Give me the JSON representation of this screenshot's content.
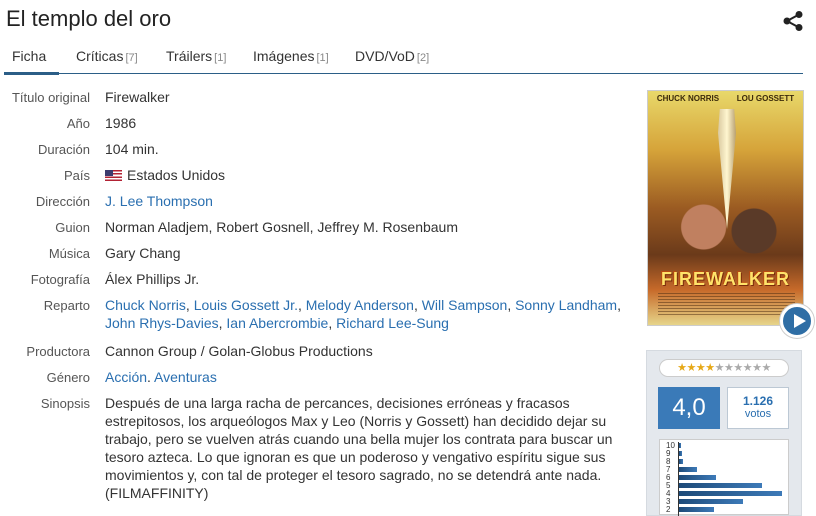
{
  "page": {
    "title": "El templo del oro"
  },
  "tabs": [
    {
      "label": "Ficha",
      "count": ""
    },
    {
      "label": "Críticas",
      "count": "[7]"
    },
    {
      "label": "Tráilers",
      "count": "[1]"
    },
    {
      "label": "Imágenes",
      "count": "[1]"
    },
    {
      "label": "DVD/VoD",
      "count": "[2]"
    }
  ],
  "details": {
    "original_title_label": "Título original",
    "original_title": "Firewalker",
    "year_label": "Año",
    "year": "1986",
    "duration_label": "Duración",
    "duration": "104 min.",
    "country_label": "País",
    "country": "Estados Unidos",
    "director_label": "Dirección",
    "director": "J. Lee Thompson",
    "screenplay_label": "Guion",
    "screenplay": "Norman Aladjem, Robert Gosnell, Jeffrey M. Rosenbaum",
    "music_label": "Música",
    "music": "Gary Chang",
    "photography_label": "Fotografía",
    "photography": "Álex Phillips Jr.",
    "cast_label": "Reparto",
    "cast": [
      "Chuck Norris",
      "Louis Gossett Jr.",
      "Melody Anderson",
      "Will Sampson",
      "Sonny Landham",
      "John Rhys-Davies",
      "Ian Abercrombie",
      "Richard Lee-Sung"
    ],
    "producer_label": "Productora",
    "producer": "Cannon Group / Golan-Globus Productions",
    "genre_label": "Género",
    "genre": [
      "Acción",
      "Aventuras"
    ],
    "synopsis_label": "Sinopsis",
    "synopsis": "Después de una larga racha de percances, decisiones erróneas y fracasos estrepitosos, los arqueólogos Max y Leo (Norris y Gossett) han decidido dejar su trabajo, pero se vuelven atrás cuando una bella mujer los contrata para buscar un tesoro azteca. Lo que ignoran es que un poderoso y vengativo espíritu sigue sus movimientos y, con tal de proteger el tesoro sagrado, no se detendrá ante nada. (FILMAFFINITY)"
  },
  "poster": {
    "actor_left": "CHUCK NORRIS",
    "actor_right": "LOU GOSSETT",
    "title": "FIREWALKER"
  },
  "rating": {
    "average": "4,0",
    "votes_count": "1.126",
    "votes_label": "votos",
    "stars_filled": 4,
    "stars_total": 10,
    "histogram_labels": [
      "10",
      "9",
      "8",
      "7",
      "6",
      "5",
      "4",
      "3",
      "2"
    ],
    "histogram_fractions": [
      0.02,
      0.03,
      0.04,
      0.17,
      0.35,
      0.78,
      0.97,
      0.6,
      0.33
    ]
  },
  "colors": {
    "accent": "#2b5e87",
    "link": "#2a6fb0",
    "rating_bg": "#3a7ab8"
  }
}
